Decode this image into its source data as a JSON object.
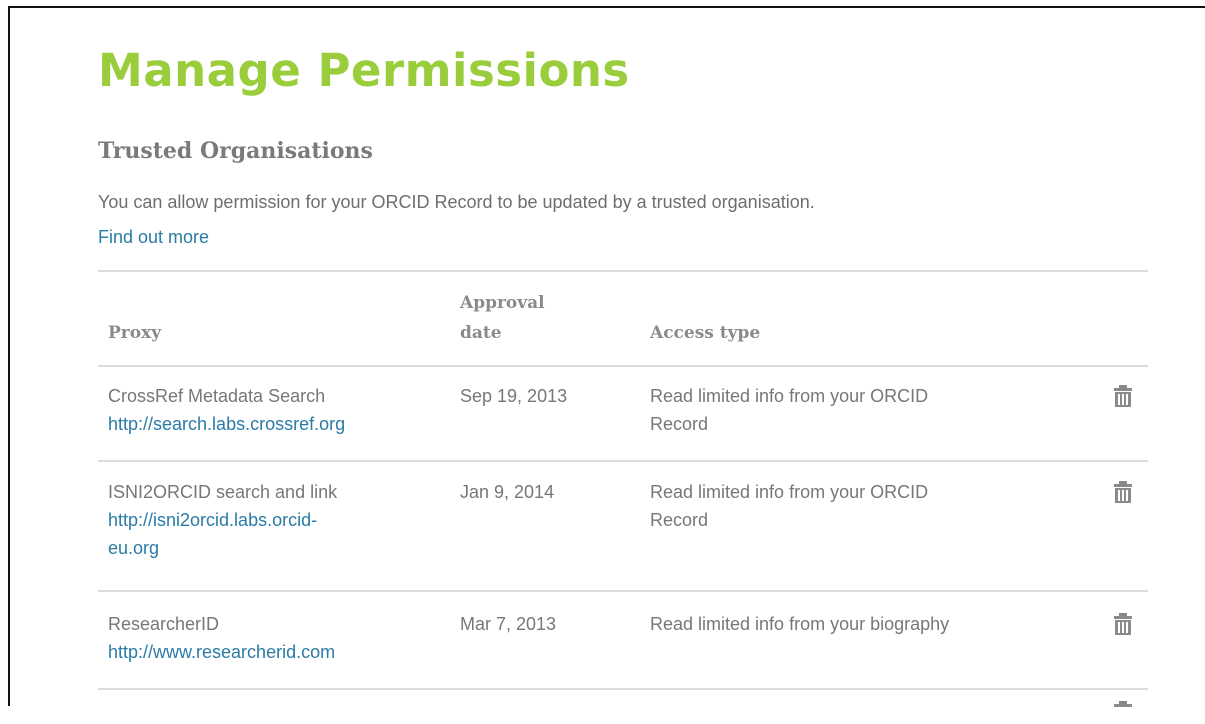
{
  "page": {
    "title": "Manage Permissions"
  },
  "trusted_organisations": {
    "heading": "Trusted Organisations",
    "description": "You can allow permission for your ORCID Record to be updated by a trusted organisation.",
    "find_out_more": "Find out more"
  },
  "table": {
    "headers": {
      "proxy": "Proxy",
      "approval_line1": "Approval",
      "approval_line2": "date",
      "access_type": "Access type"
    },
    "rows": [
      {
        "name": "CrossRef Metadata Search",
        "url": "http://search.labs.crossref.org",
        "date": "Sep 19, 2013",
        "access_line1": "Read limited info from your ORCID",
        "access_line2": "Record"
      },
      {
        "name": "ISNI2ORCID search and link",
        "url_line1": "http://isni2orcid.labs.orcid-",
        "url_line2": "eu.org",
        "date": "Jan 9, 2014",
        "access_line1": "Read limited info from your ORCID",
        "access_line2": "Record"
      },
      {
        "name": "ResearcherID",
        "url": "http://www.researcherid.com",
        "date": "Mar 7, 2013",
        "access_line1": "Read limited info from your biography"
      }
    ]
  },
  "icons": {
    "delete": "trash-icon"
  },
  "colors": {
    "title_green": "#9acd3c",
    "link_blue": "#2a7ba6",
    "text_gray": "#777777",
    "divider": "#dcdcdc"
  }
}
